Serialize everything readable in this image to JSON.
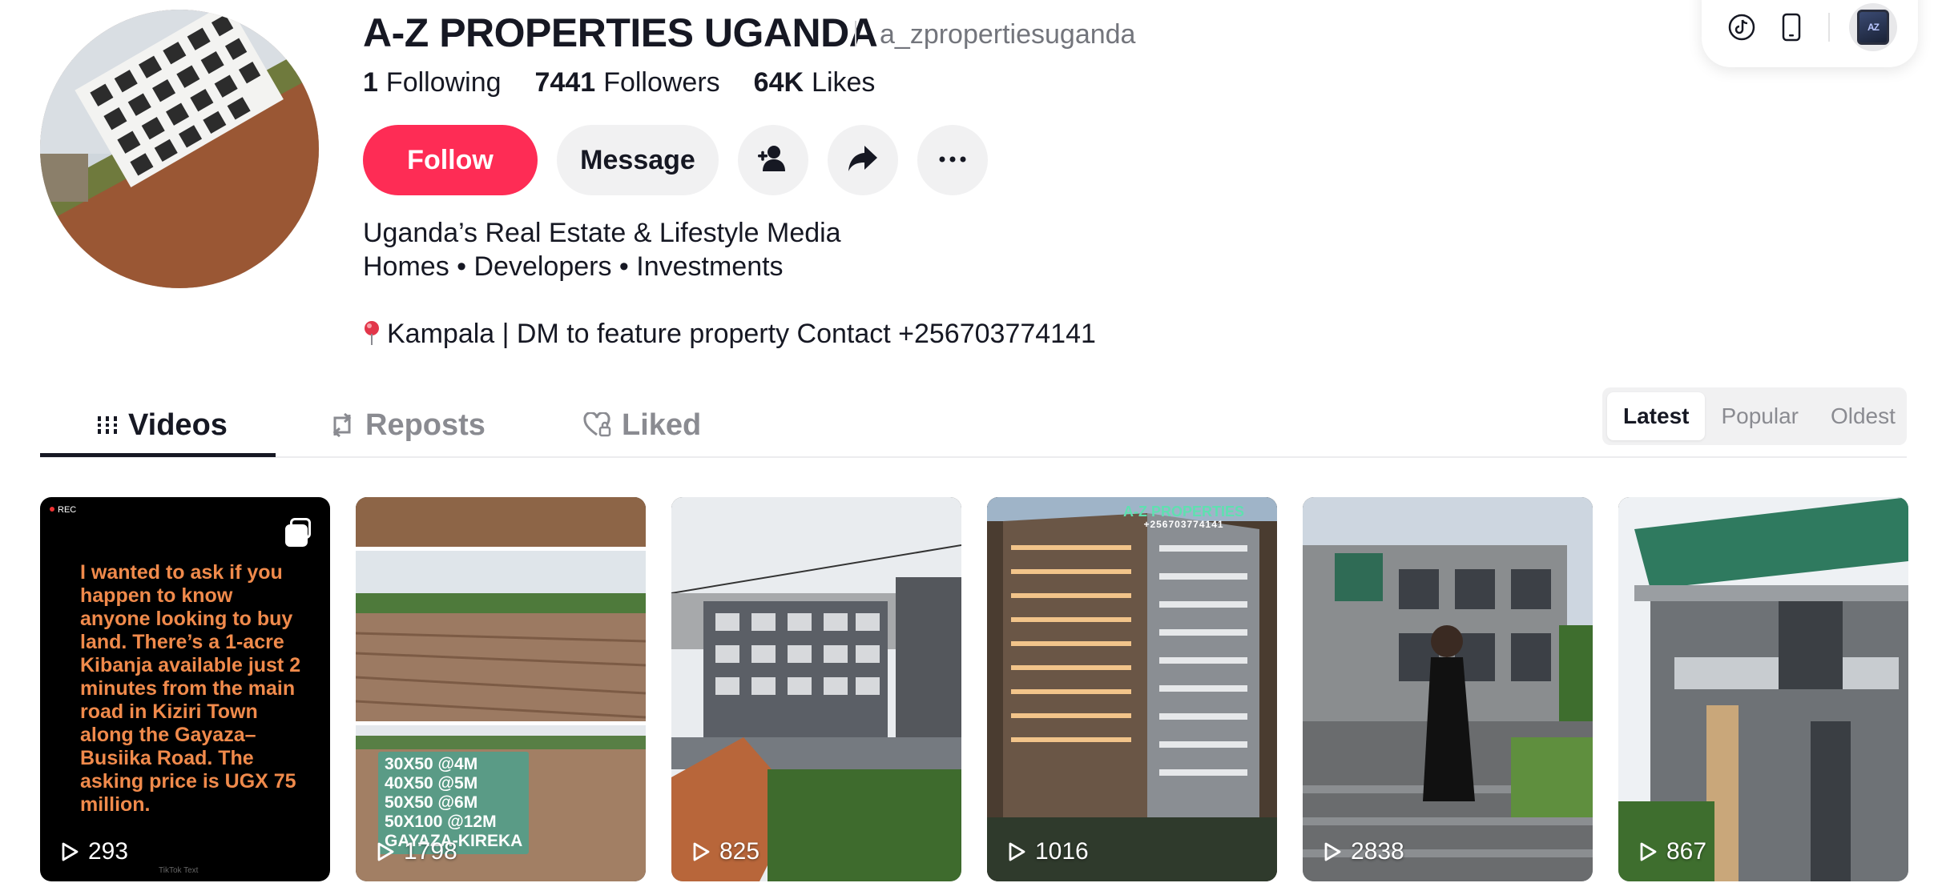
{
  "toolbar": {
    "icons": [
      "tiktok-icon",
      "mobile-icon"
    ],
    "avatar_label": "AZ"
  },
  "profile": {
    "name": "A-Z PROPERTIES UGANDA",
    "handle": "a_zpropertiesuganda",
    "stats": {
      "following_count": "1",
      "following_label": "Following",
      "followers_count": "7441",
      "followers_label": "Followers",
      "likes_count": "64K",
      "likes_label": "Likes"
    },
    "actions": {
      "follow_label": "Follow",
      "message_label": "Message"
    },
    "bio": {
      "line1": "Uganda’s Real Estate & Lifestyle Media",
      "line2": "Homes • Developers • Investments",
      "location": "Kampala | DM to feature property Contact +256703774141"
    }
  },
  "tabs": {
    "videos": "Videos",
    "reposts": "Reposts",
    "liked": "Liked"
  },
  "sort": {
    "options": [
      "Latest",
      "Popular",
      "Oldest"
    ],
    "selected": "Latest"
  },
  "videos": [
    {
      "views": "293",
      "rec_label": "REC",
      "overlay_text": "I wanted to ask if you happen to know anyone looking to buy land. There’s a 1-acre Kibanja available just 2 minutes from the main road in Kiziri Town along the Gayaza–Busiika Road. The asking price is UGX 75 million.",
      "watermark": "TikTok Text"
    },
    {
      "views": "1798",
      "price_lines": [
        "30X50 @4M",
        "40X50 @5M",
        "50X50 @6M",
        "50X100 @12M",
        "GAYAZA-KIREKA"
      ]
    },
    {
      "views": "825"
    },
    {
      "views": "1016",
      "brand_title": "A-Z PROPERTIES",
      "brand_phone": "+256703774141"
    },
    {
      "views": "2838"
    },
    {
      "views": "867"
    }
  ],
  "colors": {
    "follow_accent": "#fe2c55",
    "text_primary": "#161823",
    "text_secondary": "#73757c"
  }
}
